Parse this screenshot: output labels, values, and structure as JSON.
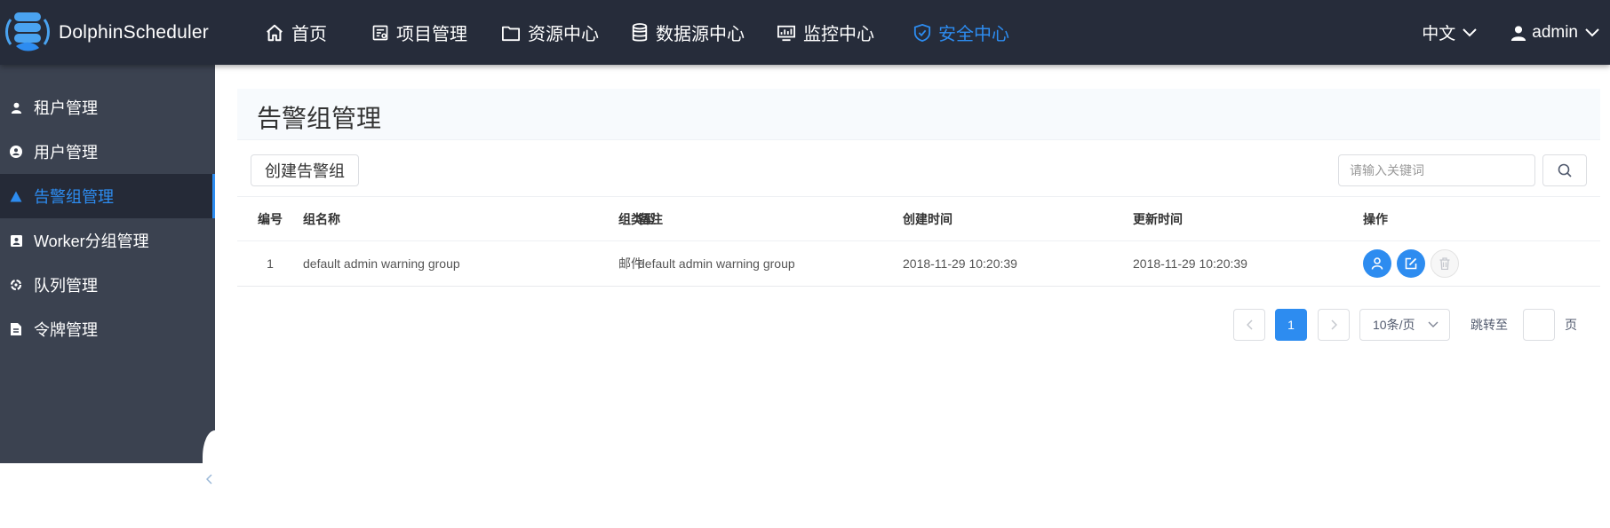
{
  "app": {
    "name": "DolphinScheduler"
  },
  "nav": {
    "items": [
      {
        "label": "首页",
        "icon": "home-icon"
      },
      {
        "label": "项目管理",
        "icon": "project-icon"
      },
      {
        "label": "资源中心",
        "icon": "folder-icon"
      },
      {
        "label": "数据源中心",
        "icon": "database-icon"
      },
      {
        "label": "监控中心",
        "icon": "monitor-icon"
      },
      {
        "label": "安全中心",
        "icon": "shield-icon",
        "active": true
      }
    ],
    "language": "中文",
    "user": "admin"
  },
  "sidebar": {
    "items": [
      {
        "label": "租户管理",
        "icon": "user-icon"
      },
      {
        "label": "用户管理",
        "icon": "user-circle-icon"
      },
      {
        "label": "告警组管理",
        "icon": "warning-icon",
        "active": true
      },
      {
        "label": "Worker分组管理",
        "icon": "worker-icon"
      },
      {
        "label": "队列管理",
        "icon": "queue-icon"
      },
      {
        "label": "令牌管理",
        "icon": "token-icon"
      }
    ]
  },
  "page": {
    "title": "告警组管理",
    "create_button": "创建告警组",
    "search_placeholder": "请输入关键词"
  },
  "table": {
    "columns": [
      "编号",
      "组名称",
      "组类型",
      "备注",
      "创建时间",
      "更新时间",
      "操作"
    ],
    "rows": [
      {
        "id": "1",
        "name": "default admin warning group",
        "type": "邮件",
        "desc": "default admin warning group",
        "created": "2018-11-29 10:20:39",
        "updated": "2018-11-29 10:20:39"
      }
    ]
  },
  "pagination": {
    "current_page": "1",
    "page_size": "10条/页",
    "jump_label": "跳转至",
    "page_label": "页"
  },
  "colors": {
    "topbar": "#262c3a",
    "sidebar": "#3b4250",
    "accent": "#2d8cf0"
  }
}
